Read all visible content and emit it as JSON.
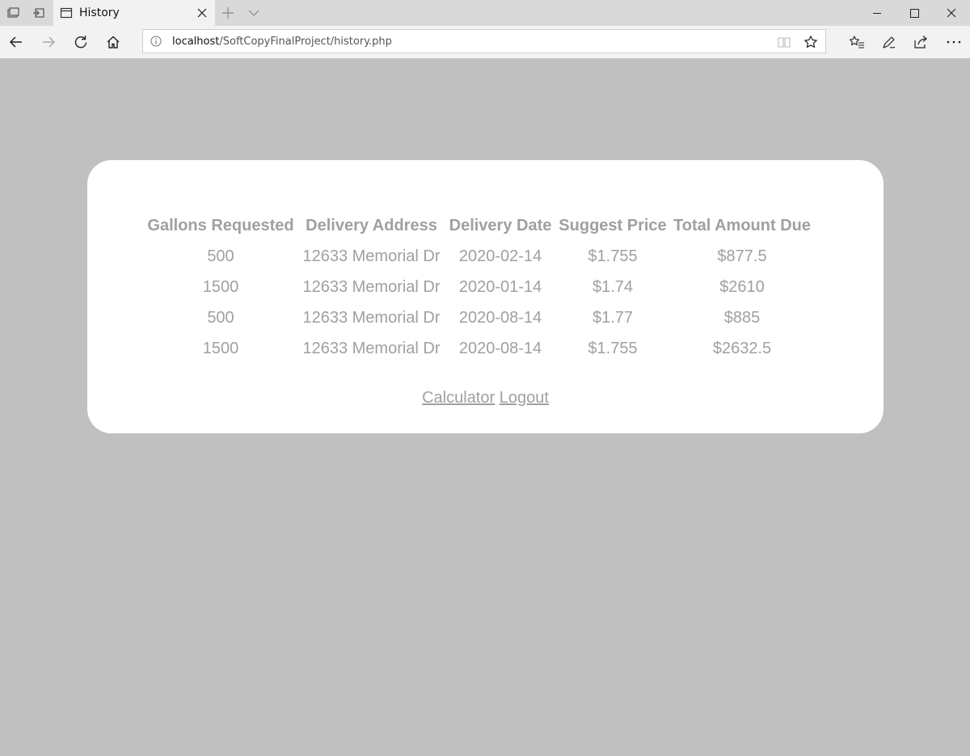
{
  "browser": {
    "tab_title": "History",
    "url_host": "localhost",
    "url_path": "/SoftCopyFinalProject/history.php"
  },
  "table": {
    "headers": [
      "Gallons Requested",
      "Delivery Address",
      "Delivery Date",
      "Suggest Price",
      "Total Amount Due"
    ],
    "rows": [
      [
        "500",
        "12633 Memorial Dr",
        "2020-02-14",
        "$1.755",
        "$877.5"
      ],
      [
        "1500",
        "12633 Memorial Dr",
        "2020-01-14",
        "$1.74",
        "$2610"
      ],
      [
        "500",
        "12633 Memorial Dr",
        "2020-08-14",
        "$1.77",
        "$885"
      ],
      [
        "1500",
        "12633 Memorial Dr",
        "2020-08-14",
        "$1.755",
        "$2632.5"
      ]
    ]
  },
  "links": {
    "calculator": "Calculator",
    "logout": "Logout"
  },
  "colors": {
    "page_background": "#c0c0c0",
    "card_background": "#ffffff",
    "text": "#a0a0a0"
  }
}
